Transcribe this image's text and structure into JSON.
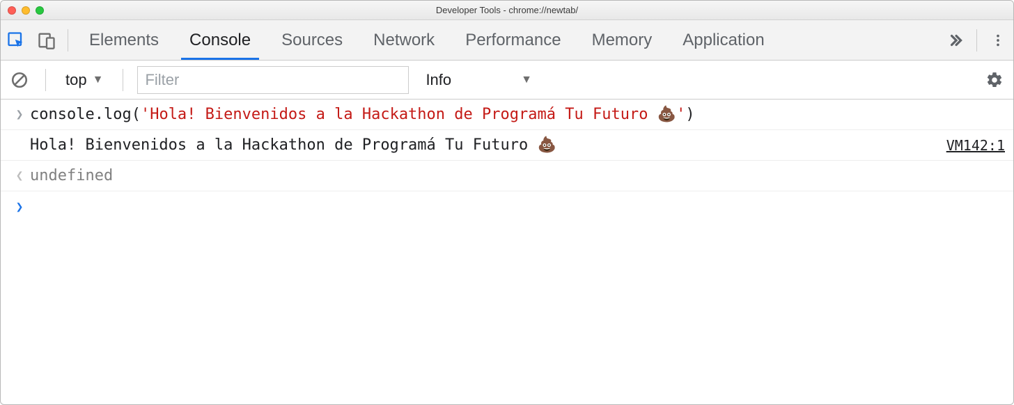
{
  "window": {
    "title": "Developer Tools - chrome://newtab/"
  },
  "tabs": {
    "items": [
      "Elements",
      "Console",
      "Sources",
      "Network",
      "Performance",
      "Memory",
      "Application"
    ],
    "active_index": 1
  },
  "filterbar": {
    "context": "top",
    "filter_placeholder": "Filter",
    "filter_value": "",
    "level": "Info"
  },
  "console": {
    "input_code_prefix": "console.log(",
    "input_code_string": "'Hola! Bienvenidos a la Hackathon de Programá Tu Futuro 💩'",
    "input_code_suffix": ")",
    "output_text": "Hola! Bienvenidos a la Hackathon de Programá Tu Futuro 💩",
    "output_source": "VM142:1",
    "return_value": "undefined"
  }
}
